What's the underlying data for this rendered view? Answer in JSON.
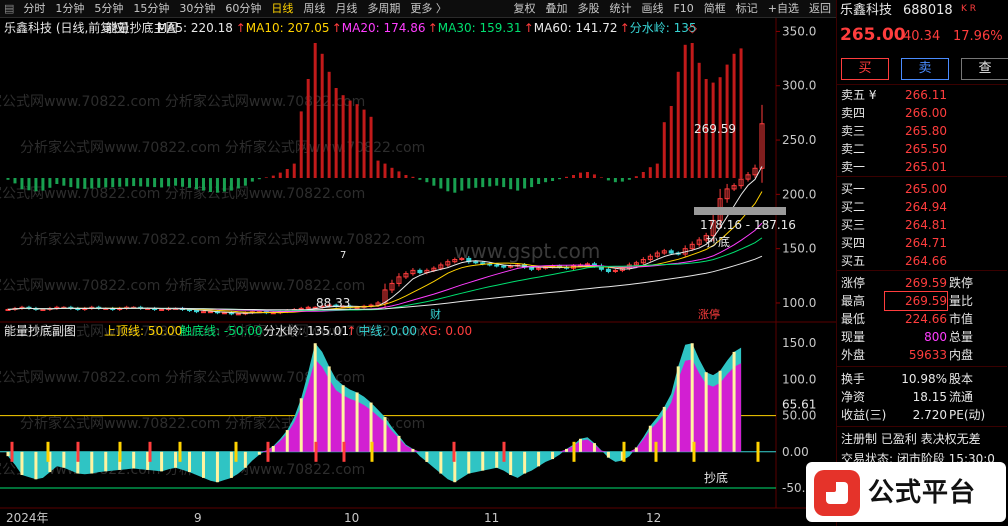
{
  "toolbar": {
    "periods": [
      {
        "label": "分时",
        "active": false
      },
      {
        "label": "1分钟",
        "active": false
      },
      {
        "label": "5分钟",
        "active": false
      },
      {
        "label": "15分钟",
        "active": false
      },
      {
        "label": "30分钟",
        "active": false
      },
      {
        "label": "60分钟",
        "active": false
      },
      {
        "label": "日线",
        "active": true
      },
      {
        "label": "周线",
        "active": false
      },
      {
        "label": "月线",
        "active": false
      },
      {
        "label": "多周期",
        "active": false
      },
      {
        "label": "更多 〉",
        "active": false
      }
    ],
    "tools": [
      "复权",
      "叠加",
      "多股",
      "统计",
      "画线",
      "F10",
      "简框",
      "标记",
      "+自选",
      "返回"
    ]
  },
  "main_panel": {
    "title": "乐鑫科技 (日线,前复权)",
    "indicator": "能量抄底主图",
    "ma": [
      {
        "label": "MA5: 220.18",
        "arrow": "↑",
        "color": "#e8e8e8"
      },
      {
        "label": "MA10: 207.05",
        "arrow": "↑",
        "color": "#ffd200"
      },
      {
        "label": "MA20: 174.86",
        "arrow": "↑",
        "color": "#ff3dff"
      },
      {
        "label": "MA30: 159.31",
        "arrow": "↑",
        "color": "#00e070"
      },
      {
        "label": "MA60: 141.72",
        "arrow": "↑",
        "color": "#e8e8e8"
      },
      {
        "label": "分水岭: 135",
        "arrow": "◇",
        "color": "#37d3d3"
      }
    ],
    "y_ticks": [
      "350.0",
      "300.0",
      "250.0",
      "200.0",
      "150.0",
      "100.0"
    ],
    "annotations": {
      "high": "269.59",
      "low": "88.33",
      "range": "178.16 - 187.16",
      "chaodi": "抄底",
      "cai": "财",
      "zhangting": "涨停",
      "mark7": "7"
    }
  },
  "sub_panel": {
    "title": "能量抄底副图",
    "params": [
      {
        "label": "上顶线: 50.00",
        "color": "#ffd200"
      },
      {
        "label": "触底线: -50.00",
        "color": "#00e070"
      },
      {
        "label": "分水岭: 135.01",
        "color": "#e8e8e8",
        "arrow": "↑"
      },
      {
        "label": "中线: 0.00",
        "color": "#37d3d3"
      },
      {
        "label": "XG: 0.00",
        "color": "#ff3d3d"
      }
    ],
    "y_ticks": [
      "150.0",
      "100.0",
      "65.61",
      "50.00",
      "0.00",
      "-50.00"
    ],
    "annotation": "抄底"
  },
  "x_axis": [
    "2024年",
    "9",
    "10",
    "11",
    "12"
  ],
  "watermark": "分析家公式网www.70822.com",
  "watermark2": "www.gspt.com",
  "stock": {
    "name": "乐鑫科技",
    "code": "688018",
    "kr": "K R",
    "price": "265.00",
    "change": "40.34",
    "pct": "17.96%",
    "buy_btn": "买",
    "sell_btn": "卖",
    "query_btn": "查"
  },
  "orderbook": {
    "asks": [
      {
        "label": "卖五 ¥",
        "price": "266.11",
        "vol": ""
      },
      {
        "label": "卖四",
        "price": "266.00",
        "vol": ""
      },
      {
        "label": "卖三",
        "price": "265.80",
        "vol": ""
      },
      {
        "label": "卖二",
        "price": "265.50",
        "vol": ""
      },
      {
        "label": "卖一",
        "price": "265.01",
        "vol": ""
      }
    ],
    "bids": [
      {
        "label": "买一",
        "price": "265.00",
        "vol": ""
      },
      {
        "label": "买二",
        "price": "264.94",
        "vol": ""
      },
      {
        "label": "买三",
        "price": "264.81",
        "vol": ""
      },
      {
        "label": "买四",
        "price": "264.71",
        "vol": ""
      },
      {
        "label": "买五",
        "price": "264.66",
        "vol": ""
      }
    ]
  },
  "stats": [
    {
      "l1": "涨停",
      "v1": "269.59",
      "v1c": "red",
      "l2": "跌停"
    },
    {
      "l1": "最高",
      "v1": "269.59",
      "v1c": "red",
      "l2": "量比",
      "box": true
    },
    {
      "l1": "最低",
      "v1": "224.66",
      "v1c": "red",
      "l2": "市值"
    },
    {
      "l1": "现量",
      "v1": "800",
      "v1c": "mag",
      "l2": "总量"
    },
    {
      "l1": "外盘",
      "v1": "59633",
      "v1c": "red",
      "l2": "内盘"
    }
  ],
  "stats2": [
    {
      "l1": "换手",
      "v1": "10.98%",
      "l2": "股本"
    },
    {
      "l1": "净资",
      "v1": "18.15",
      "l2": "流通"
    },
    {
      "l1": "收益(三)",
      "v1": "2.720",
      "l2": "PE(动)"
    }
  ],
  "footer": {
    "flags": "注册制 已盈利 表决权无差",
    "status": "交易状态: 闭市阶段 15:30:0"
  },
  "logo": {
    "text": "公式平台",
    "sub": "www.gspt.com"
  },
  "chart_data": {
    "type": "candlestick",
    "note_candles": "approx daily closes, Aug-Dec 2024",
    "closes": [
      94,
      95,
      96,
      95,
      94,
      94,
      95,
      96,
      96,
      95,
      94,
      95,
      96,
      95,
      95,
      94,
      95,
      96,
      96,
      95,
      95,
      94,
      94,
      95,
      95,
      94,
      93,
      92,
      92,
      92,
      91,
      91,
      90,
      90,
      91,
      92,
      92,
      91,
      91,
      92,
      93,
      94,
      95,
      96,
      96,
      97,
      98,
      97,
      97,
      96,
      96,
      97,
      98,
      100,
      112,
      118,
      124,
      127,
      130,
      128,
      130,
      132,
      135,
      138,
      140,
      141,
      138,
      137,
      136,
      135,
      134,
      133,
      134,
      135,
      133,
      131,
      132,
      133,
      134,
      133,
      132,
      134,
      135,
      136,
      134,
      131,
      129,
      130,
      132,
      135,
      137,
      140,
      143,
      146,
      148,
      146,
      145,
      150,
      154,
      158,
      162,
      176,
      196,
      205,
      208,
      214,
      218,
      224,
      265
    ],
    "sub_values": [
      -6,
      -18,
      -32,
      -35,
      -38,
      -36,
      -28,
      -20,
      -22,
      -26,
      -30,
      -31,
      -30,
      -28,
      -27,
      -26,
      -25,
      -24,
      -23,
      -24,
      -25,
      -26,
      -27,
      -24,
      -22,
      -25,
      -28,
      -32,
      -36,
      -40,
      -42,
      -39,
      -36,
      -30,
      -22,
      -12,
      -4,
      2,
      8,
      18,
      30,
      48,
      74,
      110,
      150,
      138,
      118,
      100,
      92,
      86,
      82,
      76,
      68,
      58,
      48,
      34,
      22,
      10,
      4,
      -6,
      -14,
      -22,
      -30,
      -38,
      -42,
      -36,
      -30,
      -28,
      -26,
      -24,
      -22,
      -26,
      -32,
      -36,
      -30,
      -26,
      -20,
      -14,
      -10,
      -4,
      4,
      10,
      18,
      20,
      12,
      2,
      -8,
      -14,
      -12,
      -6,
      6,
      20,
      36,
      48,
      62,
      80,
      118,
      148,
      150,
      128,
      110,
      106,
      112,
      126,
      138,
      144
    ]
  }
}
